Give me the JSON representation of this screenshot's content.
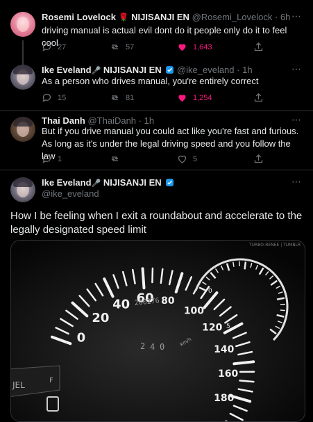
{
  "tweets": [
    {
      "name": "Rosemi Lovelock",
      "name_emoji": "🌹",
      "org": "NIJISANJI EN",
      "handle": "@Rosemi_Lovelock",
      "time": "· 6h",
      "text": "driving manual is actual evil dont do it people only do it to feel cool",
      "replies": "27",
      "retweets": "57",
      "likes": "1,643",
      "liked": true
    },
    {
      "name": "Ike Eveland",
      "org": "NIJISANJI EN",
      "handle": "@ike_eveland",
      "time": "· 1h",
      "text": "As a person who drives manual, you're entirely correct",
      "replies": "15",
      "retweets": "81",
      "likes": "1,254",
      "liked": true
    },
    {
      "name": "Thai Danh",
      "handle": "@ThaiDanh",
      "time": "· 1h",
      "text": "But if you drive manual you could act like you're fast and furious. As long as it's under the legal driving speed and you follow the law",
      "replies": "1",
      "retweets": "",
      "likes": "5",
      "liked": false
    }
  ],
  "main_tweet": {
    "name": "Ike Eveland",
    "org": "NIJISANJI EN",
    "handle": "@ike_eveland",
    "text": "How I be feeling when I exit a roundabout and accelerate to the legally designated speed limit",
    "media_watermark": "TURBO-RENEE | TUMBLR",
    "gauge_labels": [
      "0",
      "20",
      "40",
      "60",
      "80",
      "100",
      "120",
      "140",
      "160",
      "180"
    ],
    "odometer": "200276",
    "unit": "km/h",
    "fuel_label": "JEL",
    "fuel_full": "F",
    "tach_digits": [
      "0",
      "5"
    ],
    "sub_digits": [
      "2",
      "4",
      "0"
    ]
  },
  "more_icon": "⋯",
  "colors": {
    "background": "#000000",
    "text": "#e7e9ea",
    "muted": "#71767b",
    "like": "#f91880",
    "verified": "#1d9bf0",
    "divider": "#2f3336"
  },
  "icons": [
    "reply-icon",
    "retweet-icon",
    "like-icon",
    "share-icon",
    "more-icon",
    "verified-icon",
    "rose-icon",
    "microphone-icon"
  ]
}
